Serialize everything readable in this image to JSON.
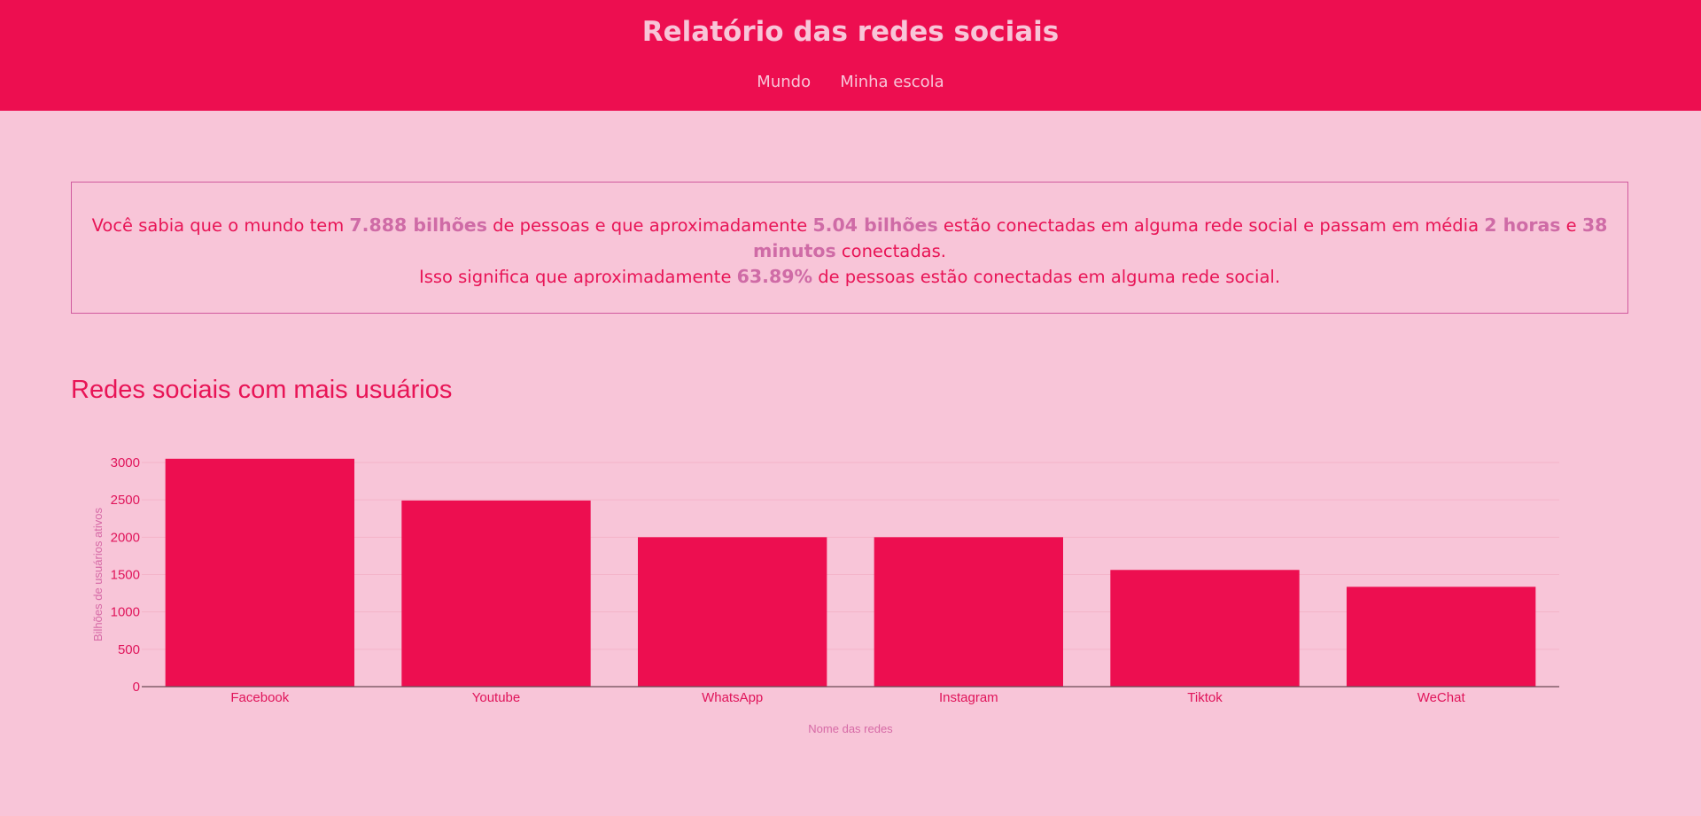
{
  "header": {
    "title": "Relatório das redes sociais",
    "nav": [
      {
        "label": "Mundo"
      },
      {
        "label": "Minha escola"
      }
    ]
  },
  "info": {
    "line1_a": "Você sabia que o mundo tem ",
    "population": "7.888 bilhões",
    "line1_b": " de pessoas e que aproximadamente ",
    "connected": "5.04 bilhões",
    "line1_c": " estão conectadas em alguma rede social e passam em média ",
    "hours": "2 horas",
    "line1_d": " e ",
    "minutes": "38 minutos",
    "line1_e": " conectadas.",
    "line2_a": "Isso significa que aproximadamente ",
    "percent": "63.89%",
    "line2_b": " de pessoas estão conectadas em alguma rede social."
  },
  "section": {
    "title": "Redes sociais com mais usuários"
  },
  "colors": {
    "bar": "#ed0e50",
    "grid": "#f4b4c9",
    "axis": "#6b4a55"
  },
  "chart_data": {
    "type": "bar",
    "categories": [
      "Facebook",
      "Youtube",
      "WhatsApp",
      "Instagram",
      "Tiktok",
      "WeChat"
    ],
    "values": [
      3050,
      2491,
      2000,
      2000,
      1562,
      1336
    ],
    "xlabel": "Nome das redes",
    "ylabel": "Bilhões de usuários ativos",
    "ylim": [
      0,
      3000
    ],
    "yticks": [
      0,
      500,
      1000,
      1500,
      2000,
      2500,
      3000
    ],
    "grid": true
  }
}
